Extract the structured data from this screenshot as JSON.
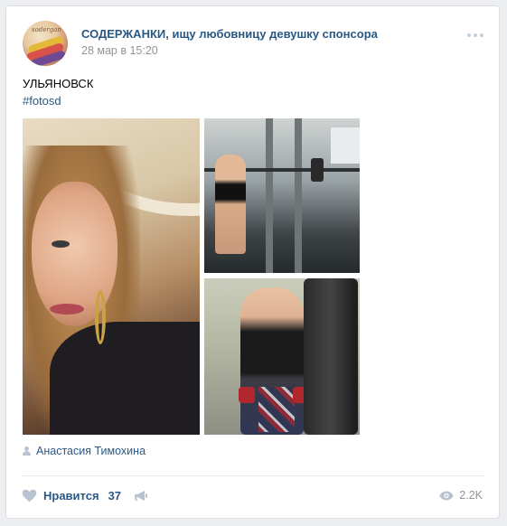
{
  "post": {
    "group_name": "СОДЕРЖАНКИ, ищу любовницу девушку спонсора",
    "date": "28 мар в 15:20",
    "title": "УЛЬЯНОВСК",
    "hashtag": "#fotosd",
    "author": "Анастасия Тимохина"
  },
  "footer": {
    "like_label": "Нравится",
    "like_count": "37",
    "views": "2.2K"
  },
  "colors": {
    "link": "#2a5885",
    "muted": "#939393",
    "icon": "#b7c3d1"
  },
  "icons": {
    "like": "heart-icon",
    "share": "megaphone-icon",
    "views": "eye-icon",
    "author": "person-icon",
    "menu": "more-dots-icon"
  }
}
